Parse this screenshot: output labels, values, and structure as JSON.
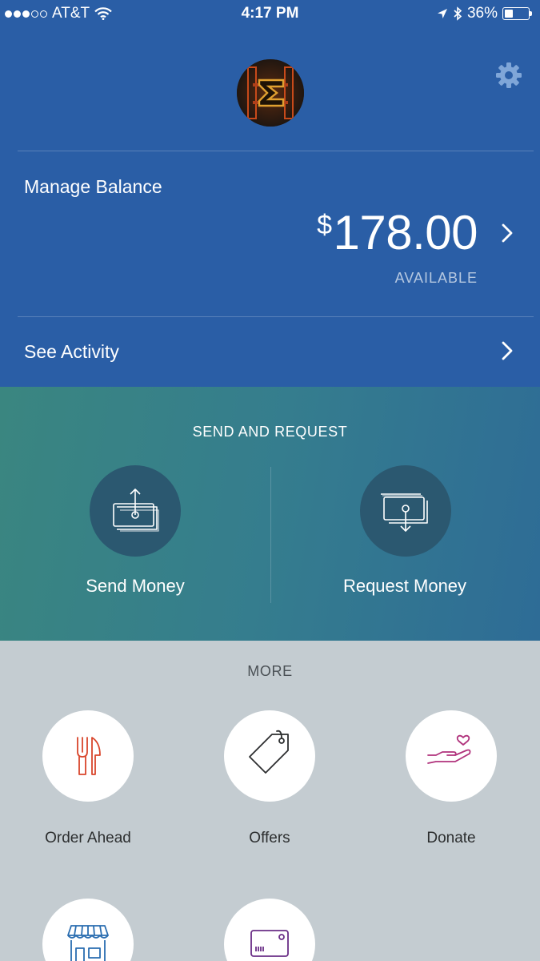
{
  "status_bar": {
    "carrier": "AT&T",
    "time": "4:17 PM",
    "battery_percent": "36%",
    "battery_level": 0.36,
    "signal_bars_filled": 3,
    "signal_bars_total": 5,
    "icons": [
      "wifi-icon",
      "location-icon",
      "bluetooth-icon",
      "battery-icon"
    ]
  },
  "header": {
    "avatar": "profile-avatar",
    "settings_icon": "gear-icon"
  },
  "balance": {
    "label": "Manage Balance",
    "currency_symbol": "$",
    "amount": "178.00",
    "sub_label": "AVAILABLE"
  },
  "activity": {
    "label": "See Activity"
  },
  "send_request": {
    "title": "SEND AND REQUEST",
    "actions": [
      {
        "label": "Send Money",
        "icon": "send-money-icon"
      },
      {
        "label": "Request Money",
        "icon": "request-money-icon"
      }
    ]
  },
  "more": {
    "title": "MORE",
    "items": [
      {
        "label": "Order Ahead",
        "icon": "fork-knife-icon",
        "color": "#d9452b"
      },
      {
        "label": "Offers",
        "icon": "price-tag-icon",
        "color": "#2c2e2f"
      },
      {
        "label": "Donate",
        "icon": "heart-hand-icon",
        "color": "#b0327c"
      },
      {
        "icon": "storefront-icon",
        "color": "#2a6db0"
      },
      {
        "icon": "card-icon",
        "color": "#6a2e86"
      }
    ]
  },
  "colors": {
    "brand_blue": "#2a5ea6",
    "teal_gradient_start": "#3a8680",
    "teal_gradient_end": "#2e6c96",
    "action_circle": "#2b5870",
    "more_background": "#c4ccd1"
  }
}
